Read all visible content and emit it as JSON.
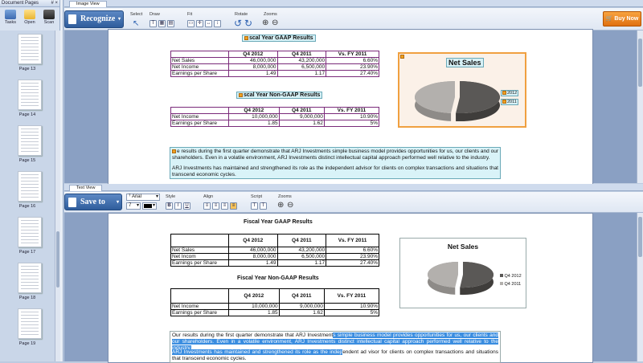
{
  "doc_panel": {
    "title": "Document Pages",
    "controls": "# ×",
    "tools": [
      {
        "label": "Tasks",
        "icon": "tasks-icon"
      },
      {
        "label": "Open",
        "icon": "folder-icon"
      },
      {
        "label": "Scan",
        "icon": "scanner-icon"
      }
    ],
    "pages": [
      "Page 13",
      "Page 14",
      "Page 15",
      "Page 16",
      "Page 17",
      "Page 18",
      "Page 19"
    ]
  },
  "image_view": {
    "tab": "Image View",
    "recognize": "Recognize",
    "groups": {
      "select": "Select",
      "draw": "Draw",
      "fit": "Fit",
      "rotate": "Rotate",
      "zoom": "Zooms"
    },
    "buy": "Buy Now"
  },
  "text_view": {
    "tab": "Text View",
    "save": "Save to",
    "font": "Arial",
    "size": "7",
    "groups": {
      "style": "Style",
      "align": "Align",
      "script": "Script",
      "zoom": "Zooms"
    }
  },
  "doc": {
    "gaap_title": "Fiscal Year GAAP Results",
    "gaap_title_img": "scal Year GAAP Results",
    "gaap_headers": [
      "",
      "Q4 2012",
      "Q4 2011",
      "Vs. FY 2011"
    ],
    "gaap_rows": [
      [
        "Net Sales",
        "46,000,000",
        "43,200,000",
        "6.60%"
      ],
      [
        "Net Income",
        "8,000,000",
        "6,500,000",
        "23.90%"
      ],
      [
        "Earnings per Share",
        "1.49",
        "1.17",
        "27.40%"
      ]
    ],
    "gaap_row2_text": "Net Incom",
    "gaap_row3_text": "Earnings per Share",
    "nongaap_title": "Fiscal Year Non-GAAP Results",
    "nongaap_title_img": "scal Year Non-GAAP Results",
    "nongaap_headers": [
      "",
      "Q4 2012",
      "Q4 2011",
      "Vs. FY 2011"
    ],
    "nongaap_rows": [
      [
        "Net Income",
        "10,000,000",
        "9,000,000",
        "10.90%"
      ],
      [
        "Earnings per Share",
        "1.85",
        "1.62",
        "5%"
      ]
    ],
    "para1_img": "e results during the first quarter demonstrate that ARJ Investments simple business model provides opportunities for us, our clients and our shareholders. Even in a volatile environment, ARJ Investments distinct intellectual capital approach performed well relative to the industry.",
    "para2_img": "ARJ Investments has maintained and strengthened its role as the independent advisor for clients on complex transactions and situations that transcend economic cycles.",
    "para1_a": "Our results during the first quarter demonstrate that ARJ Investment",
    "para1_b": "s simple business model provides opportunities for us, our clients and our shareholders. Even in a volatile environment, ARJ Investments distinct intellectual capital approach performed well relative to the industry.",
    "para2_a": "ARJ Investments has maintained and strengthened its role as the indep",
    "para2_b": "endent ad visor for clients on complex transactions and situations that transcend economic cycles."
  },
  "chart_data": {
    "type": "pie",
    "title": "Net Sales",
    "title_img": "Net Sales",
    "categories": [
      "Q4 2012",
      "Q4 2011"
    ],
    "values": [
      46000000,
      43200000
    ],
    "legend_img": [
      "2012",
      "2011"
    ],
    "legend": "right",
    "colors": [
      "#5a5856",
      "#b3b0ad"
    ]
  }
}
